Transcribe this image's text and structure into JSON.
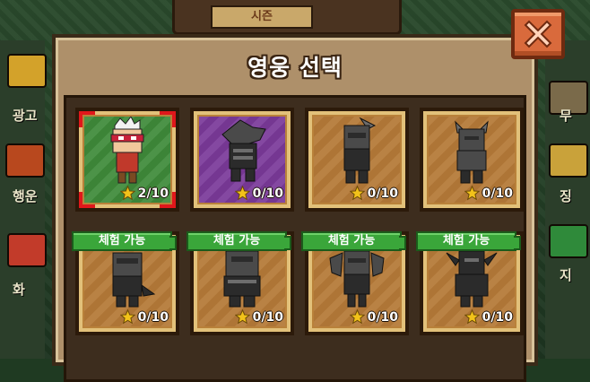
{
  "background": {
    "top_tab_label": "시즌",
    "left_labels": [
      "광고",
      "행운",
      "화"
    ],
    "right_labels": [
      "무",
      "징",
      "지"
    ]
  },
  "dialog": {
    "title": "영웅 선택",
    "close_icon": "close-x-icon"
  },
  "heroes": [
    {
      "level": "2/10",
      "bg": "green",
      "selected": true,
      "trial": false,
      "sprite": "hero-red-bandana"
    },
    {
      "level": "0/10",
      "bg": "purple",
      "selected": false,
      "trial": false,
      "sprite": "hero-shark"
    },
    {
      "level": "0/10",
      "bg": "orange",
      "selected": false,
      "trial": false,
      "sprite": "hero-ninja"
    },
    {
      "level": "0/10",
      "bg": "orange",
      "selected": false,
      "trial": false,
      "sprite": "hero-helmet-knight"
    },
    {
      "level": "0/10",
      "bg": "orange",
      "selected": false,
      "trial": true,
      "sprite": "hero-wolf"
    },
    {
      "level": "0/10",
      "bg": "orange",
      "selected": false,
      "trial": true,
      "sprite": "hero-armored"
    },
    {
      "level": "0/10",
      "bg": "orange",
      "selected": false,
      "trial": true,
      "sprite": "hero-winged"
    },
    {
      "level": "0/10",
      "bg": "orange",
      "selected": false,
      "trial": true,
      "sprite": "hero-dark-knight"
    }
  ],
  "trial_label": "체험 가능",
  "colors": {
    "trial_green": "#3aa63a",
    "selection_red": "#e0171b",
    "star_yellow": "#f2c21a",
    "panel_tan": "#ae906a"
  }
}
